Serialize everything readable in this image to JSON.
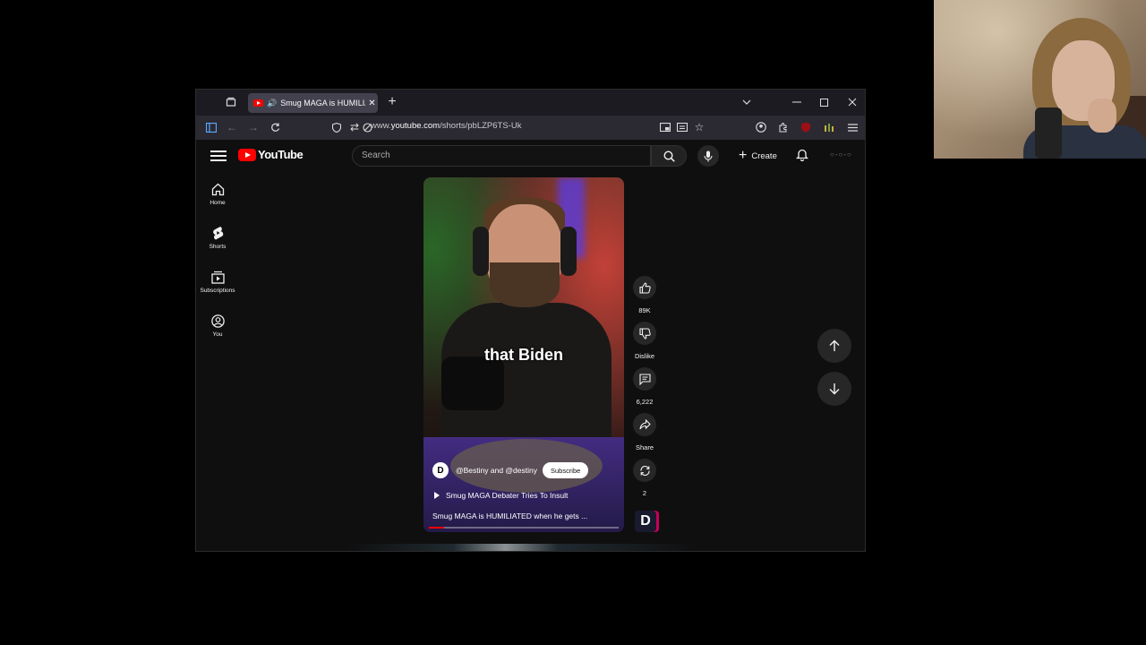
{
  "browser": {
    "tab_title": "Smug MAGA is HUMILIATED",
    "url_prefix": "www.",
    "url_host": "youtube.com",
    "url_path": "/shorts/pbLZP6TS-Uk"
  },
  "youtube": {
    "logo_text": "YouTube",
    "search_placeholder": "Search",
    "create_label": "Create",
    "sidebar": [
      {
        "label": "Home",
        "icon": "home-icon"
      },
      {
        "label": "Shorts",
        "icon": "shorts-icon"
      },
      {
        "label": "Subscriptions",
        "icon": "subscriptions-icon"
      },
      {
        "label": "You",
        "icon": "account-icon"
      }
    ],
    "short": {
      "caption": "that Biden",
      "channel_avatar_letter": "D",
      "channel": "@Bestiny and @destiny",
      "subscribe_label": "Subscribe",
      "playlist": "Smug MAGA Debater Tries To Insult",
      "title": "Smug MAGA is HUMILIATED when he gets ...",
      "progress": 0.08
    },
    "actions": {
      "likes": "89K",
      "dislike_label": "Dislike",
      "comments": "6,222",
      "share_label": "Share",
      "remix_count": "2",
      "channel_logo_letter": "D"
    }
  },
  "colors": {
    "brand_red": "#ff0000",
    "page_bg": "#0f0f0f",
    "button_bg": "#272727"
  }
}
